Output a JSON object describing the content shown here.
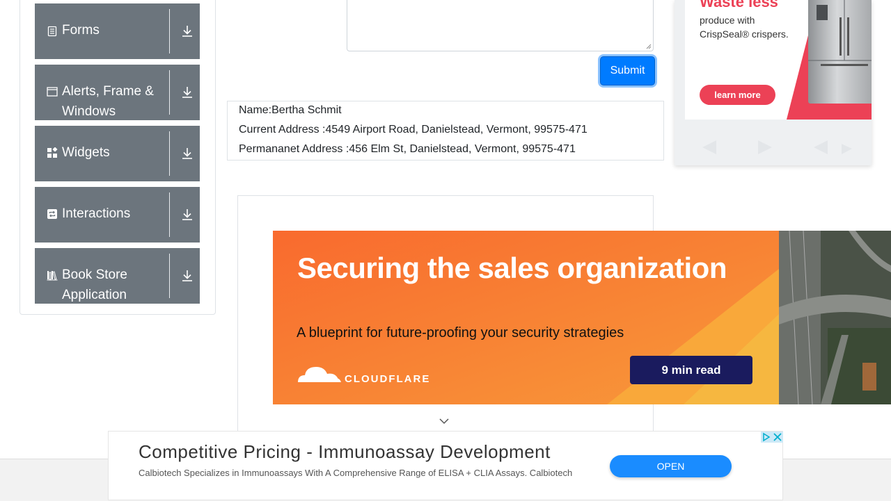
{
  "sidebar": {
    "groups": [
      {
        "label": "Forms",
        "icon": "document-icon"
      },
      {
        "label": "Alerts, Frame & Windows",
        "icon": "window-icon"
      },
      {
        "label": "Widgets",
        "icon": "widgets-icon"
      },
      {
        "label": "Interactions",
        "icon": "interactions-icon"
      },
      {
        "label": "Book Store Application",
        "icon": "books-icon"
      }
    ]
  },
  "form": {
    "submit_label": "Submit"
  },
  "output": {
    "name": "Name:Bertha Schmit",
    "current_address": "Current Address :4549 Airport Road, Danielstead, Vermont, 99575-471",
    "permanent_address": "Permananet Address :456 Elm St, Danielstead, Vermont, 99575-471"
  },
  "right_ad": {
    "headline": "Waste less",
    "subtext": "produce with CrispSeal® crispers.",
    "button": "learn more",
    "accent": "#ec4156"
  },
  "cloudflare_ad": {
    "headline": "Securing the sales organization",
    "subtext": "A blueprint for future-proofing your security strategies",
    "button": "9 min read",
    "brand": "CLOUDFLARE",
    "bg_orange": "#f6821f"
  },
  "bottom_ad": {
    "headline": "Competitive Pricing - Immunoassay Development",
    "description": "Calbiotech Specializes in Immunoassays With A Comprehensive Range of ELISA + CLIA Assays. Calbiotech",
    "button": "OPEN",
    "accent": "#1a8cff"
  },
  "colors": {
    "sidebar_group_bg": "#6c757d",
    "primary": "#007bff"
  }
}
